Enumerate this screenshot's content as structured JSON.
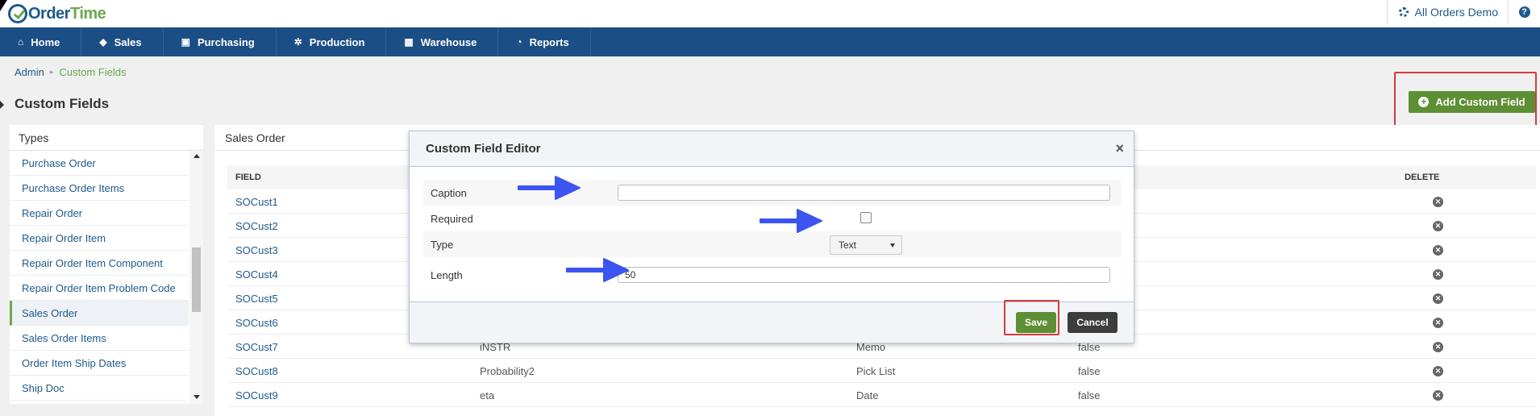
{
  "app": {
    "logo_part1": "Order",
    "logo_part2": "Time",
    "company": "All Orders Demo",
    "help": "?"
  },
  "nav": {
    "items": [
      {
        "label": "Home",
        "icon": "home-icon"
      },
      {
        "label": "Sales",
        "icon": "tag-icon"
      },
      {
        "label": "Purchasing",
        "icon": "cart-icon"
      },
      {
        "label": "Production",
        "icon": "gears-icon"
      },
      {
        "label": "Warehouse",
        "icon": "box-icon"
      },
      {
        "label": "Reports",
        "icon": "pie-chart-icon"
      }
    ]
  },
  "breadcrumb": {
    "admin": "Admin",
    "current": "Custom Fields"
  },
  "page": {
    "title": "Custom Fields",
    "add_button": "Add Custom Field"
  },
  "types": {
    "header": "Types",
    "items": [
      "Purchase Order",
      "Purchase Order Items",
      "Repair Order",
      "Repair Order Item",
      "Repair Order Item Component",
      "Repair Order Item Problem Code",
      "Sales Order",
      "Sales Order Items",
      "Order Item Ship Dates",
      "Ship Doc"
    ],
    "selected": "Sales Order"
  },
  "main": {
    "header": "Sales Order",
    "columns": {
      "field": "FIELD",
      "delete": "DELETE"
    },
    "rows": [
      {
        "field": "SOCust1",
        "caption": "",
        "type": "",
        "required": ""
      },
      {
        "field": "SOCust2",
        "caption": "",
        "type": "",
        "required": ""
      },
      {
        "field": "SOCust3",
        "caption": "",
        "type": "",
        "required": ""
      },
      {
        "field": "SOCust4",
        "caption": "",
        "type": "",
        "required": ""
      },
      {
        "field": "SOCust5",
        "caption": "",
        "type": "",
        "required": ""
      },
      {
        "field": "SOCust6",
        "caption": "",
        "type": "",
        "required": ""
      },
      {
        "field": "SOCust7",
        "caption": "iNSTR",
        "type": "Memo",
        "required": "false"
      },
      {
        "field": "SOCust8",
        "caption": "Probability2",
        "type": "Pick List",
        "required": "false"
      },
      {
        "field": "SOCust9",
        "caption": "eta",
        "type": "Date",
        "required": "false"
      }
    ]
  },
  "modal": {
    "title": "Custom Field Editor",
    "close": "×",
    "fields": {
      "caption_label": "Caption",
      "caption_value": "",
      "required_label": "Required",
      "required_checked": false,
      "type_label": "Type",
      "type_value": "Text",
      "length_label": "Length",
      "length_value": "50"
    },
    "save": "Save",
    "cancel": "Cancel"
  },
  "colors": {
    "nav_bg": "#1b4e85",
    "brand_blue": "#1e5a8c",
    "brand_green": "#6aa84f",
    "button_green": "#5d8f35",
    "highlight_red": "#d83a3a",
    "arrow_blue": "#3c55f0"
  }
}
